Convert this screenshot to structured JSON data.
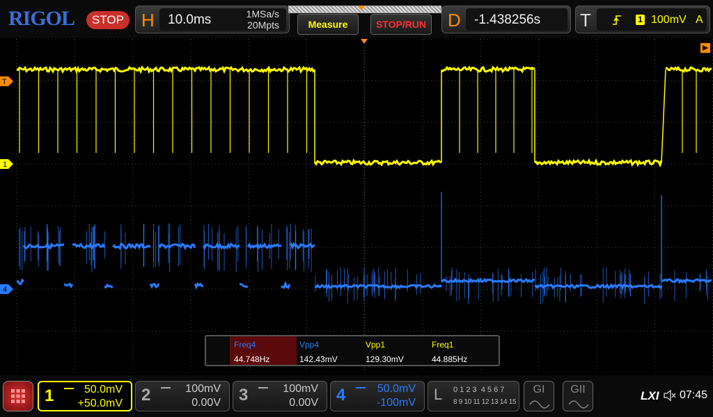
{
  "brand": {
    "logo": "RIGOL"
  },
  "run_state": "STOP",
  "horizontal": {
    "letter": "H",
    "timebase": "10.0ms",
    "sample_rate": "1MSa/s",
    "memory_depth": "20Mpts"
  },
  "buttons": {
    "measure": "Measure",
    "stop_run": "STOP/RUN"
  },
  "delay": {
    "letter": "D",
    "value": "-1.438256s"
  },
  "trigger": {
    "letter": "T",
    "source": "1",
    "level": "100mV",
    "mode": "A"
  },
  "markers": {
    "trigger_level": "T",
    "ch1": "1",
    "ch4": "4"
  },
  "measurements": [
    {
      "name": "Freq4",
      "value": "44.748Hz",
      "color": "#2a7bff",
      "highlight": true
    },
    {
      "name": "Vpp4",
      "value": "142.43mV",
      "color": "#2a7bff",
      "highlight": false
    },
    {
      "name": "Vpp1",
      "value": "129.30mV",
      "color": "#ffff00",
      "highlight": false
    },
    {
      "name": "Freq1",
      "value": "44.885Hz",
      "color": "#ffff00",
      "highlight": false
    }
  ],
  "channels": [
    {
      "num": "1",
      "scale": "50.0mV",
      "offset": "+50.0mV",
      "active": true,
      "color": "#ffff00"
    },
    {
      "num": "2",
      "scale": "100mV",
      "offset": "0.00V",
      "active": false,
      "color": "#aaaaaa"
    },
    {
      "num": "3",
      "scale": "100mV",
      "offset": "0.00V",
      "active": false,
      "color": "#aaaaaa"
    },
    {
      "num": "4",
      "scale": "50.0mV",
      "offset": "-100mV",
      "active": true,
      "color": "#2a7bff"
    }
  ],
  "logic": {
    "letter": "L",
    "row1": "0 1 2 3  4 5 6 7",
    "row2": "8 9 10 11 12 13 14 15"
  },
  "gens": {
    "g1": "GI",
    "g2": "GII"
  },
  "status": {
    "lxi": "LXI",
    "time": "07:45"
  },
  "colors": {
    "ch1": "#ffff00",
    "ch4": "#2a7bff",
    "accent": "#ff8c00"
  }
}
